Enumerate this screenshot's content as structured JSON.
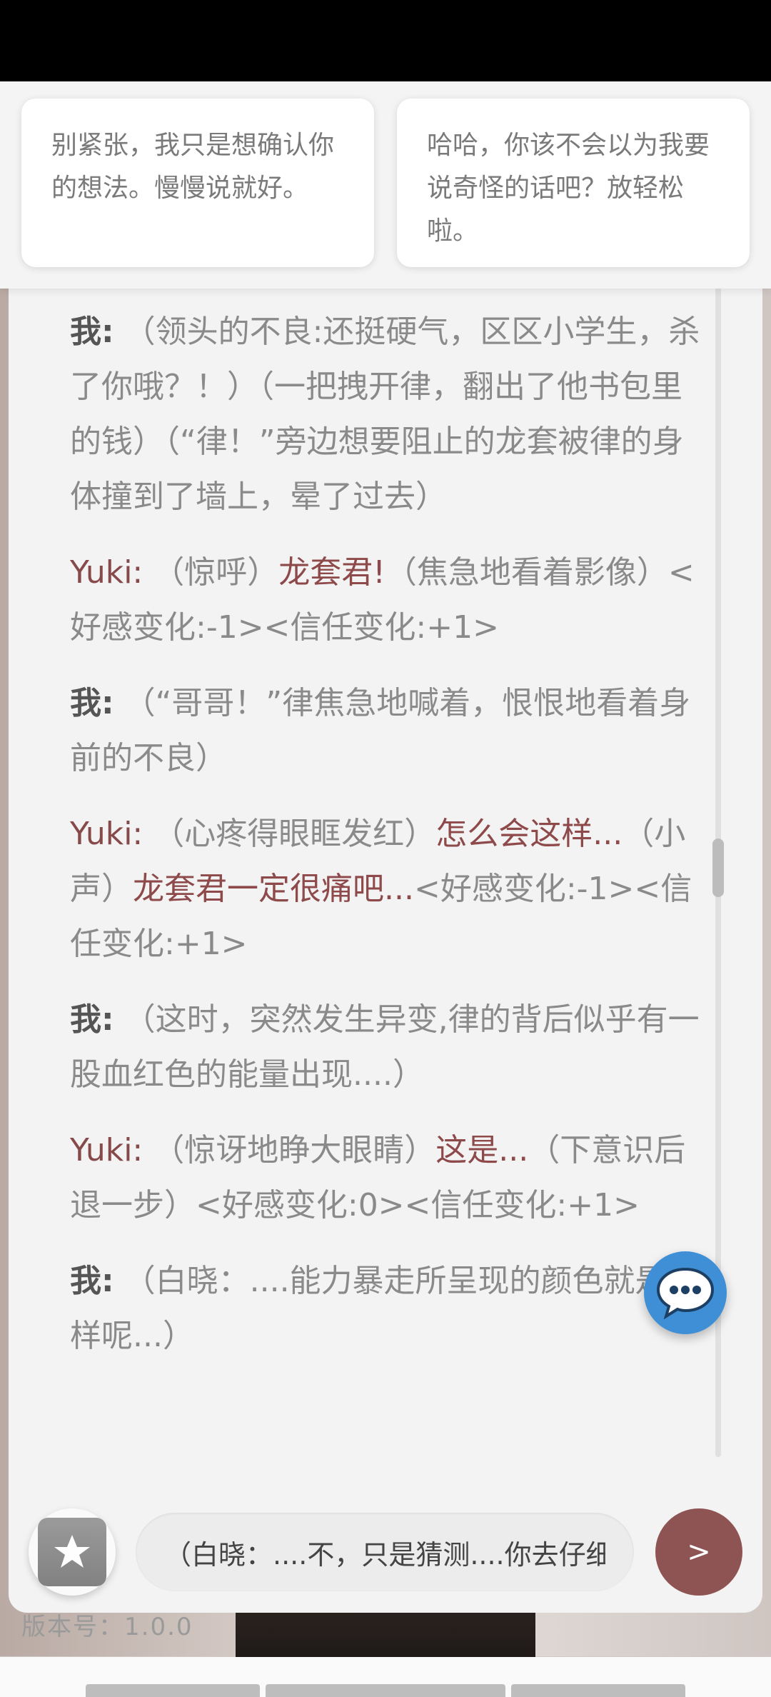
{
  "suggestions": [
    {
      "text": "别紧张，我只是想确认你的想法。慢慢说就好。"
    },
    {
      "text": "哈哈，你该不会以为我要说奇怪的话吧？放轻松啦。"
    }
  ],
  "messages": [
    {
      "speaker": "我:",
      "parts": [
        {
          "t": "（领头的不良:还挺硬气，区区小学生，杀了你哦？！）（一把拽开律，翻出了他书包里的钱）（“律！”旁边想要阻止的龙套被律的身体撞到了墙上，晕了过去）",
          "hl": false
        }
      ]
    },
    {
      "speaker": "Yuki:",
      "parts": [
        {
          "t": "（惊呼）",
          "hl": false
        },
        {
          "t": "龙套君!",
          "hl": true
        },
        {
          "t": "（焦急地看着影像）<好感变化:-1><信任变化:+1>",
          "hl": false
        }
      ]
    },
    {
      "speaker": "我:",
      "parts": [
        {
          "t": "（“哥哥！”律焦急地喊着，恨恨地看着身前的不良）",
          "hl": false
        }
      ]
    },
    {
      "speaker": "Yuki:",
      "parts": [
        {
          "t": "（心疼得眼眶发红）",
          "hl": false
        },
        {
          "t": "怎么会这样...",
          "hl": true
        },
        {
          "t": "（小声）",
          "hl": false
        },
        {
          "t": "龙套君一定很痛吧...",
          "hl": true
        },
        {
          "t": "<好感变化:-1><信任变化:+1>",
          "hl": false
        }
      ]
    },
    {
      "speaker": "我:",
      "parts": [
        {
          "t": "（这时，突然发生异变,律的背后似乎有一股血红色的能量出现....）",
          "hl": false
        }
      ]
    },
    {
      "speaker": "Yuki:",
      "parts": [
        {
          "t": "（惊讶地睁大眼睛）",
          "hl": false
        },
        {
          "t": "这是...",
          "hl": true
        },
        {
          "t": "（下意识后退一步）<好感变化:0><信任变化:+1>",
          "hl": false
        }
      ]
    },
    {
      "speaker": "我:",
      "parts": [
        {
          "t": "（白晓：....能力暴走所呈现的颜色就是这样呢...）",
          "hl": false
        }
      ]
    }
  ],
  "input": {
    "value": "（白晓：....不，只是猜测....你去仔细看看"
  },
  "send": {
    "label": ">"
  },
  "footer": {
    "version": "版本号：1.0.0"
  },
  "colors": {
    "accent": "#8e5353",
    "speaker_yuki": "#874a4a",
    "fab": "#3f8fd6"
  },
  "icons": {
    "fab": "chat-bubble-icon",
    "gift": "gift-star-icon"
  }
}
